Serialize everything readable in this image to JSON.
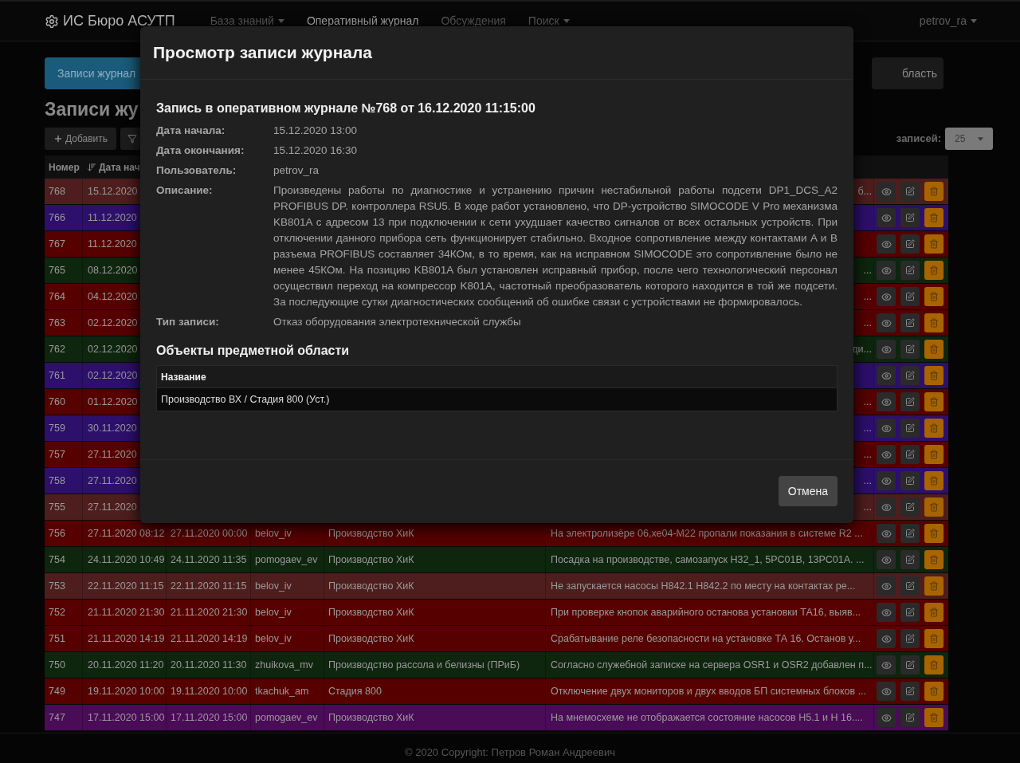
{
  "navbar": {
    "brand": "ИС Бюро АСУТП",
    "items": [
      {
        "label": "База знаний",
        "dropdown": true,
        "selected": false
      },
      {
        "label": "Оперативный журнал",
        "dropdown": false,
        "selected": true
      },
      {
        "label": "Обсуждения",
        "dropdown": false,
        "selected": false
      },
      {
        "label": "Поиск",
        "dropdown": true,
        "selected": false
      }
    ],
    "user": "petrov_ra"
  },
  "page_tabs": [
    {
      "label": "Записи журнал",
      "selected": true
    },
    {
      "label": "бласть",
      "selected": false
    }
  ],
  "heading": "Записи жу",
  "toolbar": {
    "add_button": "Добавить",
    "page_size": {
      "label": "записей:",
      "value": "25"
    }
  },
  "table": {
    "columns": [
      {
        "label": "Номер",
        "sorted": false
      },
      {
        "label": "Дата нач",
        "sorted": true
      }
    ],
    "rows": [
      {
        "number": "768",
        "start": "15.12.2020",
        "description_tail": "б...",
        "color": "#4e1d1d"
      },
      {
        "number": "766",
        "start": "11.12.2020",
        "color": "#2d0f6c"
      },
      {
        "number": "767",
        "start": "11.12.2020",
        "color": "#570000"
      },
      {
        "number": "765",
        "start": "08.12.2020",
        "description_tail": "...",
        "color": "#0e250e"
      },
      {
        "number": "764",
        "start": "04.12.2020",
        "description_tail": "...",
        "color": "#570000"
      },
      {
        "number": "763",
        "start": "02.12.2020",
        "description_tail": "...",
        "color": "#570000"
      },
      {
        "number": "762",
        "start": "02.12.2020",
        "description_tail": "ди...",
        "color": "#0e250e"
      },
      {
        "number": "761",
        "start": "02.12.2020",
        "color": "#2d0f6c"
      },
      {
        "number": "760",
        "start": "01.12.2020",
        "description_tail": "...",
        "color": "#570000"
      },
      {
        "number": "759",
        "start": "30.11.2020",
        "description_tail": "...",
        "color": "#2d0f6c"
      },
      {
        "number": "757",
        "start": "27.11.2020",
        "description_tail": "...",
        "color": "#570000"
      },
      {
        "number": "758",
        "start": "27.11.2020",
        "description_tail": "...",
        "color": "#2d0f6c"
      },
      {
        "number": "755",
        "start": "27.11.2020",
        "description_tail": "...",
        "color": "#4e1d1d"
      },
      {
        "number": "756",
        "start": "27.11.2020 08:12",
        "end": "27.11.2020 00:00",
        "user": "belov_iv",
        "object": "Производство ХиК",
        "description": "На электролизёре 06,хе04-М22 пропали показания в системе R2 ...",
        "color": "#570000"
      },
      {
        "number": "754",
        "start": "24.11.2020 10:49",
        "end": "24.11.2020 11:35",
        "user": "pomogaev_ev",
        "object": "Производство ХиК",
        "description": "Посадка на производстве, самозапуск Н32_1, 5РС01В, 13РС01А. ...",
        "color": "#0e250e"
      },
      {
        "number": "753",
        "start": "22.11.2020 11:15",
        "end": "22.11.2020 11:15",
        "user": "belov_iv",
        "object": "Производство ХиК",
        "description": "Не запускается насосы Н842.1 Н842.2 по месту на контактах ре...",
        "color": "#4e1d1d"
      },
      {
        "number": "752",
        "start": "21.11.2020 21:30",
        "end": "21.11.2020 21:30",
        "user": "belov_iv",
        "object": "Производство ХиК",
        "description": "При проверке кнопок аварийного останова установки ТА16, выяв...",
        "color": "#570000"
      },
      {
        "number": "751",
        "start": "21.11.2020 14:19",
        "end": "21.11.2020 14:19",
        "user": "belov_iv",
        "object": "Производство ХиК",
        "description": "Срабатывание реле безопасности на установке ТА 16. Останов у...",
        "color": "#570000"
      },
      {
        "number": "750",
        "start": "20.11.2020 11:20",
        "end": "20.11.2020 11:30",
        "user": "zhuikova_mv",
        "object": "Производство рассола и белизны (ПРиБ)",
        "description": "Согласно служебной записке на сервера OSR1 и OSR2 добавлен п...",
        "color": "#0e250e"
      },
      {
        "number": "749",
        "start": "19.11.2020 10:00",
        "end": "19.11.2020 10:00",
        "user": "tkachuk_am",
        "object": "Стадия 800",
        "description": "Отключение двух мониторов и двух вводов БП системных блоков ...",
        "color": "#570000"
      },
      {
        "number": "747",
        "start": "17.11.2020 15:00",
        "end": "17.11.2020 15:00",
        "user": "pomogaev_ev",
        "object": "Производство ХиК",
        "description": "На мнемосхеме не отображается состояние насосов Н5.1 и Н 16....",
        "color": "#4a0b57"
      }
    ]
  },
  "modal": {
    "title": "Просмотр записи журнала",
    "record_title": "Запись в оперативном журнале №768 от 16.12.2020 11:15:00",
    "fields": [
      {
        "label": "Дата начала:",
        "value": "15.12.2020 13:00"
      },
      {
        "label": "Дата окончания:",
        "value": "15.12.2020 16:30"
      },
      {
        "label": "Пользователь:",
        "value": "petrov_ra"
      },
      {
        "label": "Описание:",
        "value": "Произведены работы по диагностике и устранению причин нестабильной работы подсети DP1_DCS_A2 PROFIBUS DP. контроллера RSU5. В ходе работ установлено, что DP-устройство SIMOCODE V Pro механизма KB801A с адресом 13 при подключении к сети ухудшает качество сигналов от всех остальных устройств. При отключении данного прибора сеть функционирует стабильно. Входное сопротивление между контактами A и B разъема PROFIBUS составляет 34КОм, в то время, как на исправном SIMOCODE это сопротивление было не менее 45КОм. На позицию KB801A был установлен исправный прибор, после чего технологический персонал осуществил переход на компрессор K801A, частотный преобразователь которого находится в той же подсети. За последующие сутки диагностических сообщений об ошибке связи с устройствами не формировалось."
      },
      {
        "label": "Тип записи:",
        "value": "Отказ оборудования электротехнической службы"
      }
    ],
    "objects": {
      "title": "Объекты предметной области",
      "columns": [
        "Название"
      ],
      "rows": [
        "Производство ВХ / Стадия 800 (Уст.)"
      ]
    },
    "cancel_button": "Отмена"
  },
  "footer": "© 2020 Copyright: Петров Роман Андреевич"
}
